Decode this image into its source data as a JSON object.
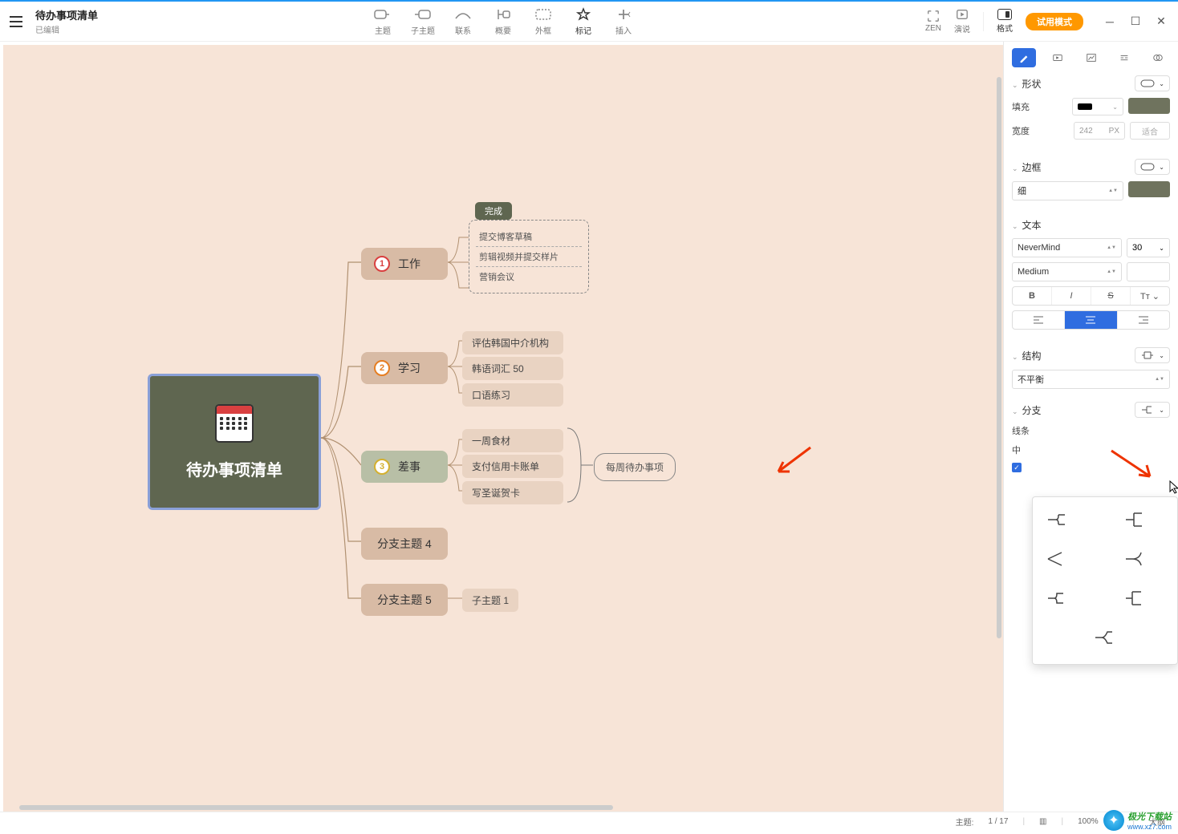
{
  "header": {
    "title": "待办事项清单",
    "subtitle": "已编辑",
    "toolbar": [
      {
        "id": "topic",
        "label": "主题"
      },
      {
        "id": "subtopic",
        "label": "子主题"
      },
      {
        "id": "relation",
        "label": "联系"
      },
      {
        "id": "summary",
        "label": "概要"
      },
      {
        "id": "boundary",
        "label": "外框"
      },
      {
        "id": "marker",
        "label": "标记"
      },
      {
        "id": "insert",
        "label": "插入"
      }
    ],
    "right": [
      {
        "id": "zen",
        "label": "ZEN"
      },
      {
        "id": "present",
        "label": "演说"
      }
    ],
    "format_label": "格式",
    "trial_label": "试用模式"
  },
  "mindmap": {
    "central": "待办事项清单",
    "done_tag": "完成",
    "branches": [
      {
        "num": 1,
        "label": "工作",
        "subs": [
          "提交博客草稿",
          "剪辑视频并提交样片",
          "营销会议"
        ],
        "hasTag": true
      },
      {
        "num": 2,
        "label": "学习",
        "subs": [
          "评估韩国中介机构",
          "韩语词汇 50",
          "口语练习"
        ]
      },
      {
        "num": 3,
        "label": "差事",
        "subs": [
          "一周食材",
          "支付信用卡账单",
          "写圣诞贺卡"
        ],
        "callout": "每周待办事项"
      },
      {
        "num": 4,
        "label": "分支主题 4"
      },
      {
        "num": 5,
        "label": "分支主题 5",
        "subs": [
          "子主题 1"
        ]
      }
    ]
  },
  "panel": {
    "shape": {
      "title": "形状"
    },
    "fill": {
      "label": "填充",
      "color": "#000"
    },
    "width": {
      "label": "宽度",
      "value": "242",
      "unit": "PX",
      "fit": "适合"
    },
    "border": {
      "title": "边框",
      "weight": "细"
    },
    "text": {
      "title": "文本",
      "font": "NeverMind",
      "size": "30",
      "weight": "Medium"
    },
    "structure": {
      "title": "结构",
      "balance": "不平衡"
    },
    "branch": {
      "title": "分支",
      "line_label": "线条",
      "mid_label": "中"
    },
    "checkbox_on": true
  },
  "status": {
    "topic_label": "主题:",
    "topic": "1 / 17",
    "zoom": "100%",
    "outline": "大纲"
  },
  "watermark": {
    "title": "极光下载站",
    "url": "www.xz7.com"
  }
}
